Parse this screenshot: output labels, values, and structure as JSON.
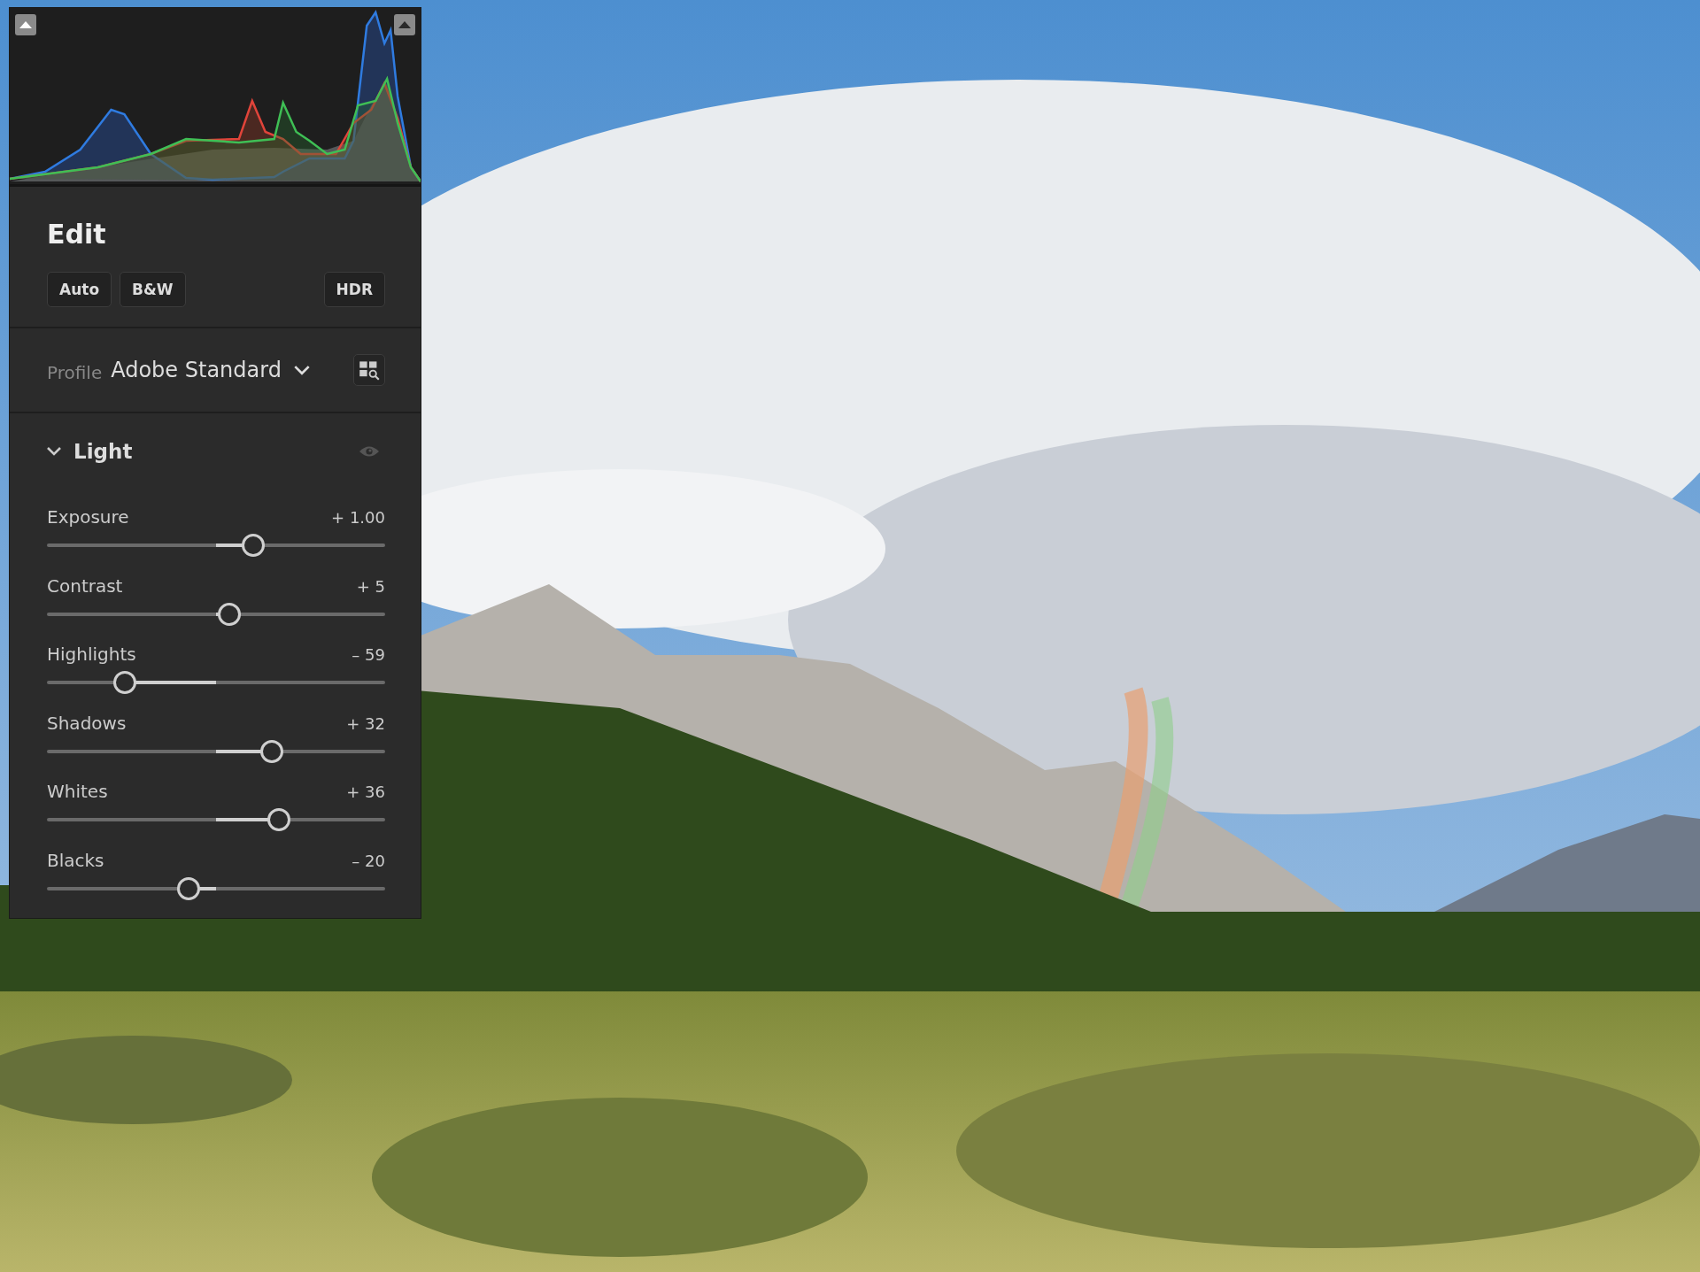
{
  "edit": {
    "title": "Edit",
    "buttons": [
      "Auto",
      "B&W",
      "HDR"
    ]
  },
  "profile": {
    "label": "Profile",
    "value": "Adobe Standard"
  },
  "light": {
    "title": "Light",
    "expanded": true,
    "sliders": [
      {
        "name": "Exposure",
        "reading": "+ 1.00",
        "level": 0.61
      },
      {
        "name": "Contrast",
        "reading": "+ 5",
        "level": 0.54
      },
      {
        "name": "Highlights",
        "reading": "– 59",
        "level": 0.23
      },
      {
        "name": "Shadows",
        "reading": "+ 32",
        "level": 0.665
      },
      {
        "name": "Whites",
        "reading": "+ 36",
        "level": 0.685
      },
      {
        "name": "Blacks",
        "reading": "– 20",
        "level": 0.42
      }
    ]
  }
}
